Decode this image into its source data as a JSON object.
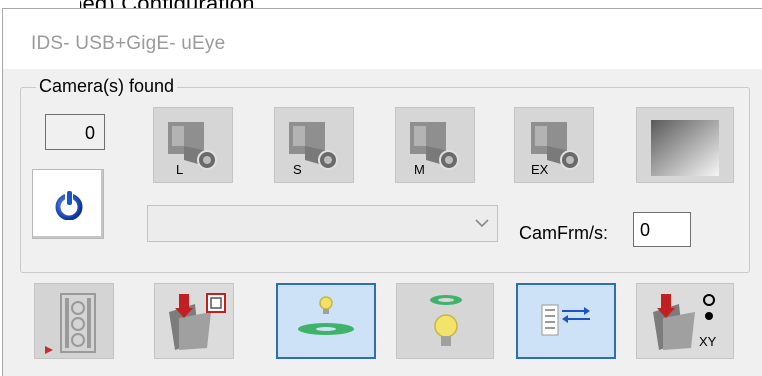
{
  "top_strip_text": "...(cropped) Configuration...",
  "window": {
    "title": "IDS- USB+GigE- uEye"
  },
  "camera_group": {
    "label": "Camera(s) found",
    "count": "0"
  },
  "camera_buttons": [
    {
      "id": "l",
      "label": "L",
      "icon": "camera-l-icon"
    },
    {
      "id": "s",
      "label": "S",
      "icon": "camera-s-icon"
    },
    {
      "id": "m",
      "label": "M",
      "icon": "camera-m-icon"
    },
    {
      "id": "ex",
      "label": "EX",
      "icon": "camera-ex-icon"
    },
    {
      "id": "gradient",
      "label": "",
      "icon": "gradient-icon"
    }
  ],
  "camera_select": {
    "value": ""
  },
  "camfrm": {
    "label": "CamFrm/s:",
    "value": "0"
  },
  "bottom_toolbar": {
    "xy_label": "XY"
  },
  "colors": {
    "window_bg": "#f0f0f0",
    "title_text": "#9a9a9a",
    "active_border": "#2d6fb1",
    "active_bg": "#cde1f7",
    "power_blue": "#1a55c4"
  }
}
